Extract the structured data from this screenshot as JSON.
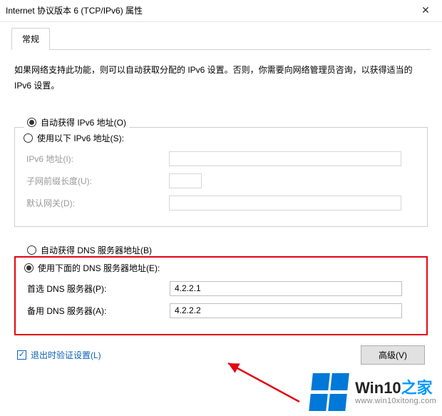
{
  "window": {
    "title": "Internet 协议版本 6 (TCP/IPv6) 属性"
  },
  "tabs": {
    "general": "常规"
  },
  "description": "如果网络支持此功能，则可以自动获取分配的 IPv6 设置。否则，你需要向网络管理员咨询，以获得适当的 IPv6 设置。",
  "ip": {
    "auto_label": "自动获得 IPv6 地址(O)",
    "manual_label": "使用以下 IPv6 地址(S):",
    "address_label": "IPv6 地址(I):",
    "prefix_label": "子网前缀长度(U):",
    "gateway_label": "默认网关(D):",
    "address_value": "",
    "prefix_value": "",
    "gateway_value": ""
  },
  "dns": {
    "auto_label": "自动获得 DNS 服务器地址(B)",
    "manual_label": "使用下面的 DNS 服务器地址(E):",
    "preferred_label": "首选 DNS 服务器(P):",
    "alternate_label": "备用 DNS 服务器(A):",
    "preferred_value": "4.2.2.1",
    "alternate_value": "4.2.2.2"
  },
  "footer": {
    "validate_label": "退出时验证设置(L)",
    "advanced_label": "高级(V)"
  },
  "watermark": {
    "brand_a": "Win10",
    "brand_b": "之家",
    "url": "www.win10xitong.com"
  }
}
